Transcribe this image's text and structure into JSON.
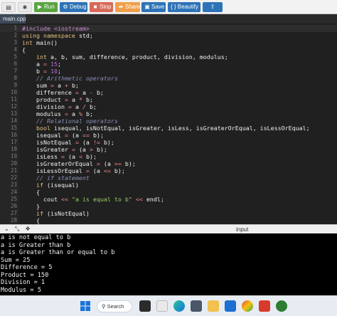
{
  "toolbar": {
    "run": "Run",
    "debug": "Debug",
    "stop": "Stop",
    "share": "Share",
    "save": "Save",
    "beautify": "{ } Beautify"
  },
  "editor": {
    "tab": "main.cpp",
    "lines": [
      {
        "n": "1",
        "segs": [
          {
            "t": "#include ",
            "c": "pp"
          },
          {
            "t": "<iostream>",
            "c": "pp"
          }
        ]
      },
      {
        "n": "2",
        "segs": [
          {
            "t": "using namespace ",
            "c": "kw"
          },
          {
            "t": "std;",
            "c": "k"
          }
        ]
      },
      {
        "n": "3",
        "segs": [
          {
            "t": "int ",
            "c": "kw"
          },
          {
            "t": "main()",
            "c": "k"
          }
        ]
      },
      {
        "n": "4",
        "segs": [
          {
            "t": "{",
            "c": "k"
          }
        ]
      },
      {
        "n": "5",
        "segs": [
          {
            "t": "    int ",
            "c": "kw"
          },
          {
            "t": "a, b, sum, difference, product, division, modulus;",
            "c": "k"
          }
        ]
      },
      {
        "n": "6",
        "segs": [
          {
            "t": "    a ",
            "c": "k"
          },
          {
            "t": "= ",
            "c": "op"
          },
          {
            "t": "15",
            "c": "nm"
          },
          {
            "t": ";",
            "c": "k"
          }
        ]
      },
      {
        "n": "7",
        "segs": [
          {
            "t": "    b ",
            "c": "k"
          },
          {
            "t": "= ",
            "c": "op"
          },
          {
            "t": "10",
            "c": "nm"
          },
          {
            "t": ";",
            "c": "k"
          }
        ]
      },
      {
        "n": "8",
        "segs": [
          {
            "t": "    // Arithmetic operators",
            "c": "cm"
          }
        ]
      },
      {
        "n": "9",
        "segs": [
          {
            "t": "    sum ",
            "c": "k"
          },
          {
            "t": "= ",
            "c": "op"
          },
          {
            "t": "a ",
            "c": "k"
          },
          {
            "t": "+ ",
            "c": "op"
          },
          {
            "t": "b;",
            "c": "k"
          }
        ]
      },
      {
        "n": "10",
        "segs": [
          {
            "t": "    difference ",
            "c": "k"
          },
          {
            "t": "= ",
            "c": "op"
          },
          {
            "t": "a ",
            "c": "k"
          },
          {
            "t": "- ",
            "c": "op"
          },
          {
            "t": "b;",
            "c": "k"
          }
        ]
      },
      {
        "n": "11",
        "segs": [
          {
            "t": "    product ",
            "c": "k"
          },
          {
            "t": "= ",
            "c": "op"
          },
          {
            "t": "a ",
            "c": "k"
          },
          {
            "t": "* ",
            "c": "op"
          },
          {
            "t": "b;",
            "c": "k"
          }
        ]
      },
      {
        "n": "12",
        "segs": [
          {
            "t": "    division ",
            "c": "k"
          },
          {
            "t": "= ",
            "c": "op"
          },
          {
            "t": "a ",
            "c": "k"
          },
          {
            "t": "/ ",
            "c": "op"
          },
          {
            "t": "b;",
            "c": "k"
          }
        ]
      },
      {
        "n": "13",
        "segs": [
          {
            "t": "    modulus ",
            "c": "k"
          },
          {
            "t": "= ",
            "c": "op"
          },
          {
            "t": "a ",
            "c": "k"
          },
          {
            "t": "% ",
            "c": "op"
          },
          {
            "t": "b;",
            "c": "k"
          }
        ]
      },
      {
        "n": "14",
        "segs": [
          {
            "t": "    // Relational operators",
            "c": "cm"
          }
        ]
      },
      {
        "n": "15",
        "segs": [
          {
            "t": "    bool ",
            "c": "kw"
          },
          {
            "t": "isequal, isNotEqual, isGreater, isLess, isGreaterOrEqual, isLessOrEqual;",
            "c": "k"
          }
        ]
      },
      {
        "n": "16",
        "segs": [
          {
            "t": "    isequal ",
            "c": "k"
          },
          {
            "t": "= ",
            "c": "op"
          },
          {
            "t": "(a ",
            "c": "k"
          },
          {
            "t": "== ",
            "c": "op"
          },
          {
            "t": "b);",
            "c": "k"
          }
        ]
      },
      {
        "n": "17",
        "segs": [
          {
            "t": "    isNotEqual ",
            "c": "k"
          },
          {
            "t": "= ",
            "c": "op"
          },
          {
            "t": "(a ",
            "c": "k"
          },
          {
            "t": "!= ",
            "c": "op"
          },
          {
            "t": "b);",
            "c": "k"
          }
        ]
      },
      {
        "n": "18",
        "segs": [
          {
            "t": "    isGreater ",
            "c": "k"
          },
          {
            "t": "= ",
            "c": "op"
          },
          {
            "t": "(a ",
            "c": "k"
          },
          {
            "t": "> ",
            "c": "op"
          },
          {
            "t": "b);",
            "c": "k"
          }
        ]
      },
      {
        "n": "19",
        "segs": [
          {
            "t": "    isLess ",
            "c": "k"
          },
          {
            "t": "= ",
            "c": "op"
          },
          {
            "t": "(a ",
            "c": "k"
          },
          {
            "t": "< ",
            "c": "op"
          },
          {
            "t": "b);",
            "c": "k"
          }
        ]
      },
      {
        "n": "20",
        "segs": [
          {
            "t": "    isGreaterOrEqual ",
            "c": "k"
          },
          {
            "t": "= ",
            "c": "op"
          },
          {
            "t": "(a ",
            "c": "k"
          },
          {
            "t": ">= ",
            "c": "op"
          },
          {
            "t": "b);",
            "c": "k"
          }
        ]
      },
      {
        "n": "21",
        "segs": [
          {
            "t": "    isLessOrEqual ",
            "c": "k"
          },
          {
            "t": "= ",
            "c": "op"
          },
          {
            "t": "(a ",
            "c": "k"
          },
          {
            "t": "<= ",
            "c": "op"
          },
          {
            "t": "b);",
            "c": "k"
          }
        ]
      },
      {
        "n": "22",
        "segs": [
          {
            "t": "    // if statement",
            "c": "cm"
          }
        ]
      },
      {
        "n": "23",
        "segs": [
          {
            "t": "    if ",
            "c": "kw"
          },
          {
            "t": "(isequal)",
            "c": "k"
          }
        ]
      },
      {
        "n": "24",
        "segs": [
          {
            "t": "    {",
            "c": "k"
          }
        ]
      },
      {
        "n": "25",
        "segs": [
          {
            "t": "      cout ",
            "c": "k"
          },
          {
            "t": "<< ",
            "c": "op"
          },
          {
            "t": "\"a is equal to b\" ",
            "c": "st"
          },
          {
            "t": "<< ",
            "c": "op"
          },
          {
            "t": "endl;",
            "c": "k"
          }
        ]
      },
      {
        "n": "26",
        "segs": [
          {
            "t": "    }",
            "c": "k"
          }
        ]
      },
      {
        "n": "27",
        "segs": [
          {
            "t": "    if ",
            "c": "kw"
          },
          {
            "t": "(isNotEqual)",
            "c": "k"
          }
        ]
      },
      {
        "n": "28",
        "segs": [
          {
            "t": "    {",
            "c": "k"
          }
        ]
      }
    ]
  },
  "panel": {
    "input_label": "input"
  },
  "output": {
    "lines": [
      "a is not equal to b",
      "a is Greater than b",
      "a is Greater than or equal to b",
      "Sum = 25",
      "Difference = 5",
      "Product = 150",
      "Division = 1",
      "Modulus = 5"
    ]
  },
  "taskbar": {
    "search": "Search"
  }
}
